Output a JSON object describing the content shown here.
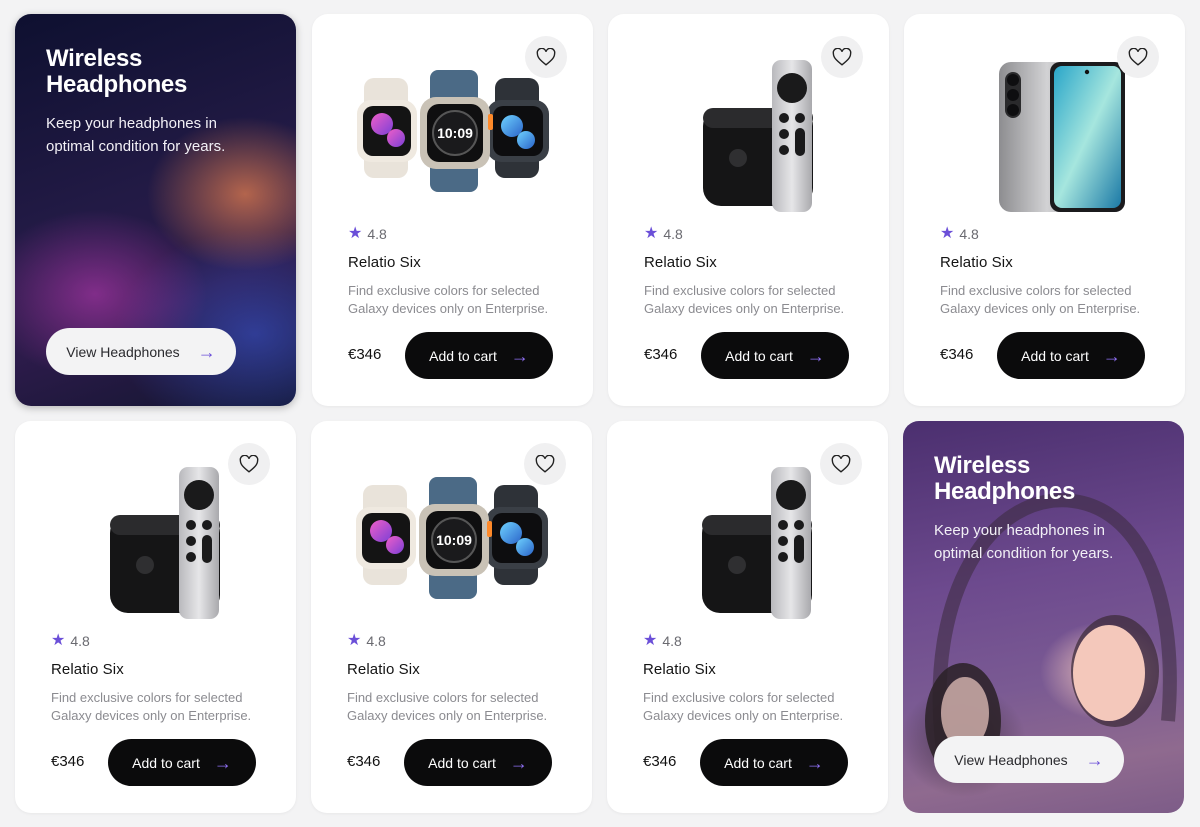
{
  "promos": [
    {
      "title_line1": "Wireless",
      "title_line2": "Headphones",
      "text": "Keep your headphones in optimal condition for years.",
      "button_label": "View Headphones"
    },
    {
      "title_line1": "Wireless",
      "title_line2": "Headphones",
      "text": "Keep your headphones in optimal condition for years.",
      "button_label": "View Headphones"
    }
  ],
  "products": [
    {
      "image": "apple-watch-trio",
      "rating": "4.8",
      "title": "Relatio Six",
      "description": "Find exclusive colors for selected Galaxy devices only on Enterprise.",
      "price": "€346",
      "cart_label": "Add to cart"
    },
    {
      "image": "apple-tv-remote",
      "rating": "4.8",
      "title": "Relatio Six",
      "description": "Find exclusive colors for selected Galaxy devices only on Enterprise.",
      "price": "€346",
      "cart_label": "Add to cart"
    },
    {
      "image": "smartphone",
      "rating": "4.8",
      "title": "Relatio Six",
      "description": "Find exclusive colors for selected Galaxy devices only on Enterprise.",
      "price": "€346",
      "cart_label": "Add to cart"
    },
    {
      "image": "apple-tv-remote",
      "rating": "4.8",
      "title": "Relatio Six",
      "description": "Find exclusive colors for selected Galaxy devices only on Enterprise.",
      "price": "€346",
      "cart_label": "Add to cart"
    },
    {
      "image": "apple-watch-trio",
      "rating": "4.8",
      "title": "Relatio Six",
      "description": "Find exclusive colors for selected Galaxy devices only on Enterprise.",
      "price": "€346",
      "cart_label": "Add to cart"
    },
    {
      "image": "apple-tv-remote",
      "rating": "4.8",
      "title": "Relatio Six",
      "description": "Find exclusive colors for selected Galaxy devices only on Enterprise.",
      "price": "€346",
      "cart_label": "Add to cart"
    }
  ],
  "icons": {
    "favorite": "heart-icon",
    "rating": "star-icon",
    "action": "arrow-right-icon"
  },
  "colors": {
    "accent": "#6b4fd8",
    "button_dark": "#0b0b0c",
    "card_bg": "#ffffff",
    "page_bg": "#f3f3f4"
  }
}
